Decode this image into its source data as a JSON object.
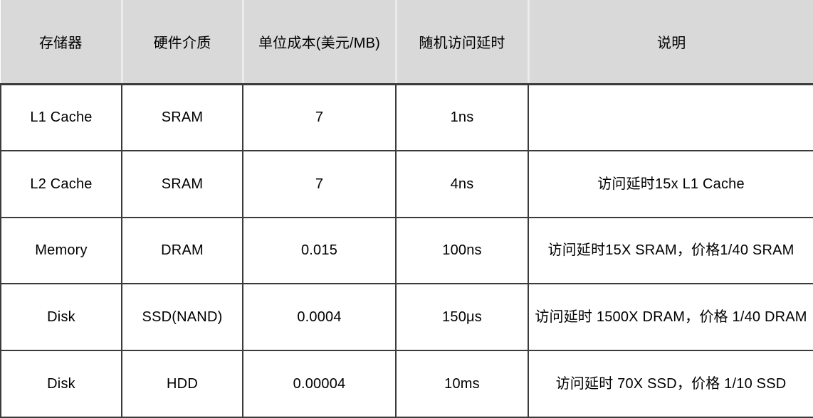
{
  "table": {
    "columns": [
      {
        "key": "storage",
        "label": "存储器"
      },
      {
        "key": "medium",
        "label": "硬件介质"
      },
      {
        "key": "cost",
        "label": "单位成本(美元/MB)"
      },
      {
        "key": "latency",
        "label": "随机访问延时"
      },
      {
        "key": "notes",
        "label": "说明"
      }
    ],
    "rows": [
      {
        "storage": "L1 Cache",
        "medium": "SRAM",
        "cost": "7",
        "latency": "1ns",
        "notes": ""
      },
      {
        "storage": "L2 Cache",
        "medium": "SRAM",
        "cost": "7",
        "latency": "4ns",
        "notes": "访问延时15x L1 Cache"
      },
      {
        "storage": "Memory",
        "medium": "DRAM",
        "cost": "0.015",
        "latency": "100ns",
        "notes": "访问延时15X SRAM，价格1/40 SRAM"
      },
      {
        "storage": "Disk",
        "medium": "SSD(NAND)",
        "cost": "0.0004",
        "latency": "150μs",
        "notes": "访问延时 1500X DRAM，价格 1/40 DRAM"
      },
      {
        "storage": "Disk",
        "medium": "HDD",
        "cost": "0.00004",
        "latency": "10ms",
        "notes": "访问延时 70X SSD，价格 1/10 SSD"
      }
    ]
  },
  "colors": {
    "header_background": "#d9d9d9",
    "header_divider": "#ebebeb",
    "body_border": "#3b3b3b",
    "body_background": "#ffffff",
    "text": "#000000"
  }
}
